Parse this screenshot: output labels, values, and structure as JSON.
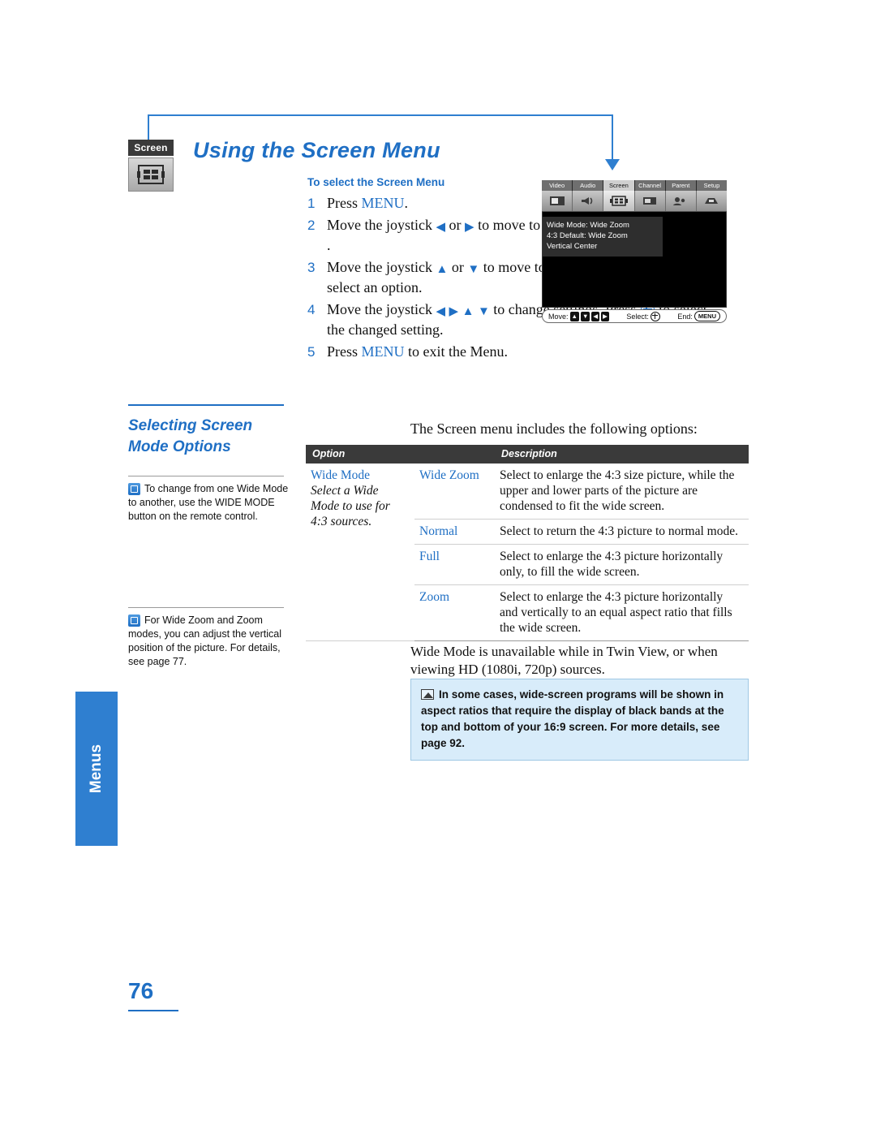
{
  "title": "Using the Screen Menu",
  "badge": {
    "label": "Screen",
    "icon": "screen-grid-icon"
  },
  "steps_section": {
    "heading": "To select the Screen Menu",
    "items": [
      {
        "num": "1",
        "html": "Press <span class=\"kw\">MENU</span>."
      },
      {
        "num": "2",
        "html": "Move the joystick <span class=\"arrow-g\">&#9664;</span> or <span class=\"arrow-g\">&#9654;</span> to move to the Screen icon and press <span class=\"joy\"></span>."
      },
      {
        "num": "3",
        "html": "Move the joystick <span class=\"arrow-g\">&#9650;</span> or <span class=\"arrow-g\">&#9660;</span> to move to an option. Press <span class=\"joy\"></span> to select an option."
      },
      {
        "num": "4",
        "html": "Move the joystick <span class=\"arrow-g\">&#9664;</span> <span class=\"arrow-g\">&#9654;</span> <span class=\"arrow-g\">&#9650;</span> <span class=\"arrow-g\">&#9660;</span> to change settings. Press <span class=\"joy\"></span> to select the changed setting."
      },
      {
        "num": "5",
        "html": "Press <span class=\"kw\">MENU</span> to exit the Menu."
      }
    ]
  },
  "osd": {
    "tabs": [
      "Video",
      "Audio",
      "Screen",
      "Channel",
      "Parent",
      "Setup"
    ],
    "selected_tab": "Screen",
    "menu_lines": [
      "Wide Mode: Wide Zoom",
      "4:3 Default: Wide Zoom",
      "Vertical Center"
    ],
    "bar": {
      "move_label": "Move:",
      "select_label": "Select:",
      "end_label": "End:",
      "end_key": "MENU"
    }
  },
  "section": {
    "heading_line1": "Selecting Screen",
    "heading_line2": "Mode Options"
  },
  "notes": [
    "To change from one Wide Mode to another, use the WIDE MODE button on the remote control.",
    "For Wide Zoom and Zoom modes, you can adjust the vertical position of the picture. For details, see page 77."
  ],
  "intro": "The Screen menu includes the following options:",
  "table": {
    "headers": [
      "Option",
      "Description"
    ],
    "rows": [
      {
        "lead_label": "Wide Mode",
        "lead_italic": "Select a Wide Mode to use for 4:3 sources.",
        "option": "Wide Zoom",
        "description": "Select to enlarge the 4:3 size picture, while the upper and lower parts of the picture are condensed to fit the wide screen."
      },
      {
        "lead_label": "",
        "lead_italic": "",
        "option": "Normal",
        "description": "Select to return the 4:3 picture to normal mode."
      },
      {
        "lead_label": "",
        "lead_italic": "",
        "option": "Full",
        "description": "Select to enlarge the 4:3 picture horizontally only, to fill the wide screen."
      },
      {
        "lead_label": "",
        "lead_italic": "",
        "option": "Zoom",
        "description": "Select to enlarge the 4:3 picture horizontally and vertically to an equal aspect ratio that fills the wide screen."
      }
    ]
  },
  "after_table": "Wide Mode is unavailable while in Twin View, or when viewing HD (1080i, 720p) sources.",
  "callout": "In some cases, wide-screen programs will be shown in aspect ratios that require the display of black bands at the top and bottom of your 16:9 screen. For more details, see page 92.",
  "side_tab": "Menus",
  "page_number": "76",
  "colors": {
    "accent": "#1f6fc4",
    "tab": "#2f7fd0",
    "callout_bg": "#d8ecfa",
    "header_bg": "#3a3a3a"
  }
}
